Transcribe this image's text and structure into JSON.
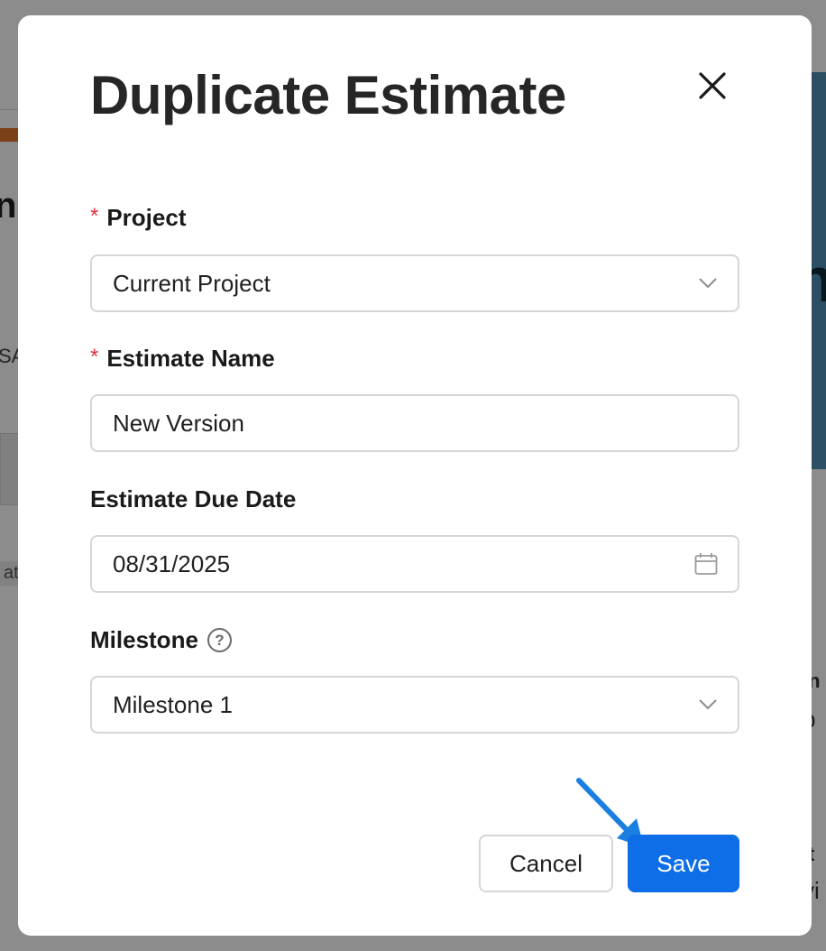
{
  "background": {
    "left_fragment_1": "n",
    "left_fragment_2": "SA",
    "left_fragment_3": "ate",
    "right_fragment_1": "n",
    "right_fragment_2": "in",
    "right_fragment_3": "p",
    "right_fragment_4": "t",
    "right_fragment_5": "vi"
  },
  "dialog": {
    "title": "Duplicate Estimate",
    "close_icon": "close-icon"
  },
  "form": {
    "project": {
      "label": "Project",
      "required_marker": "*",
      "value": "Current Project",
      "icon": "chevron-down-icon"
    },
    "estimate_name": {
      "label": "Estimate Name",
      "required_marker": "*",
      "value": "New Version"
    },
    "due_date": {
      "label": "Estimate Due Date",
      "value": "08/31/2025",
      "icon": "calendar-icon"
    },
    "milestone": {
      "label": "Milestone",
      "help_glyph": "?",
      "value": "Milestone 1",
      "icon": "chevron-down-icon"
    }
  },
  "footer": {
    "cancel_label": "Cancel",
    "save_label": "Save"
  },
  "colors": {
    "primary": "#0d6ee8",
    "required": "#e0313d",
    "annotation_arrow": "#1a7fe0"
  }
}
